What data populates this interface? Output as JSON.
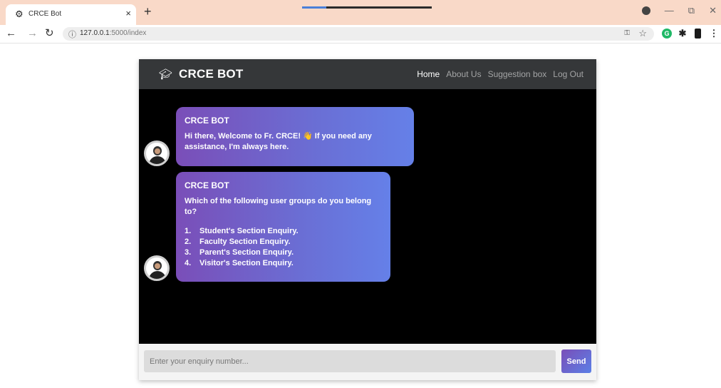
{
  "browser": {
    "tab_title": "CRCE Bot",
    "tab_close": "×",
    "new_tab": "+",
    "url_host": "127.0.0.1",
    "url_rest": ":5000/index"
  },
  "header": {
    "brand": "CRCE BOT",
    "nav": [
      "Home",
      "About Us",
      "Suggestion box",
      "Log Out"
    ],
    "active": "Home"
  },
  "messages": [
    {
      "sender": "CRCE BOT",
      "text": "Hi there, Welcome to Fr. CRCE! 👋 If you need any assistance, I'm always here."
    },
    {
      "sender": "CRCE BOT",
      "text": "Which of the following user groups do you belong to?",
      "options": [
        {
          "n": "1.",
          "label": "Student's Section Enquiry."
        },
        {
          "n": "2.",
          "label": "Faculty Section Enquiry."
        },
        {
          "n": "3.",
          "label": "Parent's Section Enquiry."
        },
        {
          "n": "4.",
          "label": "Visitor's Section Enquiry."
        }
      ]
    }
  ],
  "footer": {
    "placeholder": "Enter your enquiry number...",
    "send_label": "Send"
  },
  "colors": {
    "header_bg": "#353739",
    "bubble_start": "#7a4eb8",
    "bubble_end": "#6580e8",
    "tabbar_bg": "#f9d9c8"
  }
}
